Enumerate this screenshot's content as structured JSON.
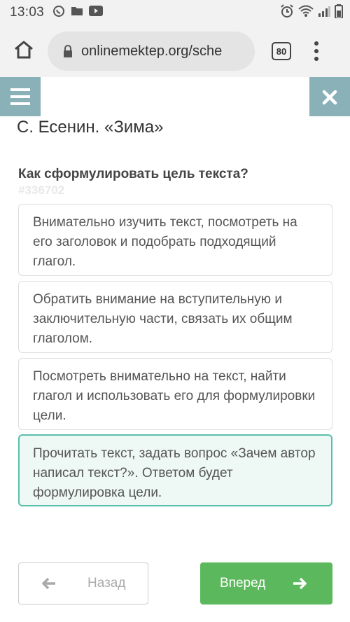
{
  "status_bar": {
    "time": "13:03",
    "icons": [
      "whatsapp-icon",
      "folder-icon",
      "youtube-icon",
      "alarm-icon",
      "wifi-icon",
      "signal-icon",
      "battery-icon"
    ]
  },
  "browser": {
    "url": "onlinemektep.org/sche",
    "tab_count": "80"
  },
  "page": {
    "lesson_title": "С. Есенин. «Зима»",
    "question": "Как сформулировать цель текста?",
    "question_id": "#336702",
    "answers": [
      {
        "text": "Внимательно изучить текст, посмотреть на его заголовок и подобрать подходящий глагол.",
        "selected": false
      },
      {
        "text": "Обратить внимание на вступительную и заключительную части, связать их общим глаголом.",
        "selected": false
      },
      {
        "text": "Посмотреть внимательно на текст, найти глагол и использовать его для формулировки цели.",
        "selected": false
      },
      {
        "text": "Прочитать текст, задать вопрос «Зачем автор написал текст?». Ответом будет формулировка цели.",
        "selected": true
      }
    ],
    "back_label": "Назад",
    "next_label": "Вперед"
  },
  "colors": {
    "header_button": "#8ab0b8",
    "selected_border": "#5bbfae",
    "selected_bg": "#eef8f5",
    "next_button": "#5cb85c"
  }
}
